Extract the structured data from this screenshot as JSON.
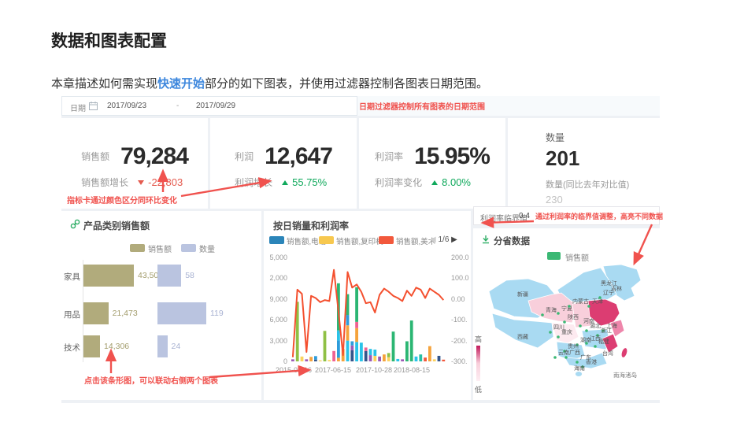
{
  "page": {
    "heading": "数据和图表配置",
    "intro_before": "本章描述如何需实现",
    "intro_link": "快速开始",
    "intro_after": "部分的如下图表，并使用过滤器控制各图表日期范围。"
  },
  "colors": {
    "annotation": "#f0524e",
    "link_blue": "#3d87dd",
    "kpi_green": "#10a95c",
    "kpi_red": "#e45a4e",
    "sales_bar": "#b1ab7c",
    "qty_bar": "#bac4e0",
    "map_green": "#3bb874",
    "line_red": "#f4502f",
    "series": {
      "green": "#2bb673",
      "lime": "#8fc045",
      "cyan": "#29c3e8",
      "yellow": "#fbd35f",
      "orange": "#f5a33c",
      "blue": "#2d9cdb",
      "navy": "#34558b",
      "purple": "#9b59b6",
      "pink": "#f06292",
      "red": "#f2583c",
      "teal": "#26bfa5"
    }
  },
  "filter_bar": {
    "label": "日期",
    "start": "2017/09/23",
    "separator": "-",
    "end": "2017/09/29"
  },
  "annotations": {
    "filter": "日期过滤器控制所有图表的日期范围",
    "kpi": "指标卡通过颜色区分同环比变化",
    "bar": "点击该条形图，可以联动右侧两个图表",
    "threshold": "通过利润率的临界值调整，高亮不同数据"
  },
  "kpi_cards": [
    {
      "label": "销售额",
      "value": "79,284",
      "sub_label": "销售额增长",
      "change": "-22,803",
      "direction": "down"
    },
    {
      "label": "利润",
      "value": "12,647",
      "sub_label": "利润增长",
      "change": "55.75%",
      "direction": "up"
    },
    {
      "label": "利润率",
      "value": "15.95%",
      "sub_label": "利润率变化",
      "change": "8.00%",
      "direction": "up"
    },
    {
      "label": "数量",
      "value": "201",
      "sub_label": "数量(同比去年对比值)",
      "compare": "230"
    }
  ],
  "bar_panel": {
    "title": "产品类别销售额",
    "legend": [
      "销售额",
      "数量"
    ],
    "rows": [
      {
        "category": "家具",
        "sales": "43,504",
        "qty": "58"
      },
      {
        "category": "用品",
        "sales": "21,473",
        "qty": "119"
      },
      {
        "category": "技术",
        "sales": "14,306",
        "qty": "24"
      }
    ]
  },
  "combo_panel": {
    "title": "按日销量和利润率",
    "legend": [
      "销售额,电话",
      "销售额,复印机",
      "销售额,美术"
    ],
    "pagination": {
      "prev": "◀",
      "label": "1/6",
      "next": "▶"
    },
    "left_axis": [
      "5,000",
      "2,000",
      "9,000",
      "6,000",
      "3,000",
      "0"
    ],
    "right_axis": [
      "200.0",
      "100.0",
      "0.00",
      "-100.",
      "-200.",
      "-300."
    ],
    "x_labels": [
      "2015-05-16",
      "2017-06-15",
      "2017-10-28",
      "2018-08-15"
    ]
  },
  "map_panel": {
    "threshold_label": "利润率临界值",
    "threshold_value": "0.4",
    "title": "分省数据",
    "legend": "销售额",
    "scale_high": "高",
    "scale_low": "低",
    "sea_label": "南海渚岛"
  },
  "chart_data": [
    {
      "type": "bar",
      "orientation": "horizontal",
      "title": "产品类别销售额",
      "categories": [
        "家具",
        "用品",
        "技术"
      ],
      "series": [
        {
          "name": "销售额",
          "values": [
            43504,
            21473,
            14306
          ]
        },
        {
          "name": "数量",
          "values": [
            58,
            119,
            24
          ]
        }
      ]
    },
    {
      "type": "bar",
      "subtype": "stacked-bars-plus-line",
      "title": "按日销量和利润率",
      "legend": [
        "销售额,电话",
        "销售额,复印机",
        "销售额,美术"
      ],
      "left_ylim": [
        0,
        15000
      ],
      "right_ylim": [
        -300,
        200
      ],
      "x_tick_labels": [
        "2015-05-16",
        "2017-06-15",
        "2017-10-28",
        "2018-08-15"
      ],
      "bars": [
        [
          [
            300,
            "purple"
          ]
        ],
        [
          [
            8600,
            "lime"
          ]
        ],
        [
          [
            700,
            "yellow"
          ]
        ],
        [
          [
            300,
            "purple"
          ]
        ],
        [
          [
            650,
            "orange"
          ]
        ],
        [
          [
            260,
            "navy"
          ],
          [
            500,
            "blue"
          ]
        ],
        [
          [
            150,
            "yellow"
          ]
        ],
        [
          [
            4400,
            "lime"
          ]
        ],
        [
          [
            200,
            "yellow"
          ]
        ],
        [
          [
            1500,
            "pink"
          ]
        ],
        [
          [
            520,
            "orange"
          ],
          [
            2500,
            "blue"
          ],
          [
            1450,
            "cyan"
          ],
          [
            6800,
            "green"
          ]
        ],
        [
          [
            1800,
            "orange"
          ]
        ],
        [
          [
            3000,
            "cyan"
          ],
          [
            2200,
            "orange"
          ],
          [
            1500,
            "blue"
          ],
          [
            3000,
            "green"
          ]
        ],
        [
          [
            1600,
            "navy"
          ],
          [
            700,
            "purple"
          ],
          [
            600,
            "blue"
          ]
        ],
        [
          [
            2800,
            "cyan"
          ],
          [
            2000,
            "orange"
          ],
          [
            900,
            "pink"
          ],
          [
            5000,
            "green"
          ]
        ],
        [
          [
            2700,
            "cyan"
          ]
        ],
        [
          [
            1500,
            "navy"
          ],
          [
            500,
            "pink"
          ]
        ],
        [
          [
            900,
            "purple"
          ],
          [
            900,
            "cyan"
          ]
        ],
        [
          [
            800,
            "yellow"
          ],
          [
            900,
            "cyan"
          ]
        ],
        [
          [
            700,
            "purple"
          ]
        ],
        [
          [
            1000,
            "orange"
          ]
        ],
        [
          [
            600,
            "yellow"
          ],
          [
            600,
            "lime"
          ]
        ],
        [
          [
            4300,
            "green"
          ]
        ],
        [
          [
            350,
            "cyan"
          ]
        ],
        [
          [
            300,
            "purple"
          ]
        ],
        [
          [
            2900,
            "green"
          ]
        ],
        [
          [
            5900,
            "green"
          ]
        ],
        [
          [
            700,
            "cyan"
          ]
        ],
        [
          [
            1000,
            "teal"
          ]
        ],
        [
          [
            550,
            "red"
          ]
        ],
        [
          [
            2200,
            "orange"
          ]
        ],
        [
          [
            300,
            "yellow"
          ]
        ],
        [
          [
            800,
            "navy"
          ]
        ],
        [
          [
            250,
            "red"
          ]
        ]
      ],
      "line": [
        -280,
        45,
        25,
        -255,
        15,
        5,
        -15,
        -5,
        -10,
        140,
        -60,
        -270,
        130,
        55,
        70,
        35,
        -20,
        -15,
        -65,
        20,
        50,
        35,
        15,
        5,
        -10,
        40,
        15,
        55,
        45,
        5,
        50,
        35,
        20,
        -5
      ]
    },
    {
      "type": "heatmap",
      "subtype": "choropleth-china",
      "title": "分省数据",
      "legend": [
        "销售额"
      ],
      "scale": [
        "高",
        "低"
      ],
      "provinces": [
        {
          "name": "新疆",
          "level": "none",
          "dot": false
        },
        {
          "name": "西藏",
          "level": "none",
          "dot": false
        },
        {
          "name": "青海",
          "level": "low",
          "dot": true
        },
        {
          "name": "宁夏",
          "level": "low",
          "dot": true
        },
        {
          "name": "陕西",
          "level": "low",
          "dot": true
        },
        {
          "name": "内蒙古",
          "level": "none",
          "dot": true
        },
        {
          "name": "天津",
          "level": "high",
          "dot": true
        },
        {
          "name": "黑龙江",
          "level": "none",
          "dot": false
        },
        {
          "name": "辽宁",
          "level": "none",
          "dot": true
        },
        {
          "name": "吉林",
          "level": "none",
          "dot": false
        },
        {
          "name": "河南",
          "level": "high",
          "dot": true
        },
        {
          "name": "四川",
          "level": "low",
          "dot": true
        },
        {
          "name": "重庆",
          "level": "low",
          "dot": true
        },
        {
          "name": "湖北",
          "level": "high",
          "dot": true
        },
        {
          "name": "上海",
          "level": "medium",
          "dot": true
        },
        {
          "name": "浙江",
          "level": "medium",
          "dot": true
        },
        {
          "name": "湖南",
          "level": "none",
          "dot": true
        },
        {
          "name": "江西",
          "level": "none",
          "dot": true
        },
        {
          "name": "福建",
          "level": "high",
          "dot": true
        },
        {
          "name": "台湾",
          "level": "high",
          "dot": false
        },
        {
          "name": "贵州",
          "level": "none",
          "dot": true
        },
        {
          "name": "云南",
          "level": "none",
          "dot": true
        },
        {
          "name": "广西",
          "level": "none",
          "dot": true
        },
        {
          "name": "广东",
          "level": "none",
          "dot": true
        },
        {
          "name": "香港",
          "level": "none",
          "dot": true
        },
        {
          "name": "海南",
          "level": "none",
          "dot": false
        }
      ]
    }
  ]
}
